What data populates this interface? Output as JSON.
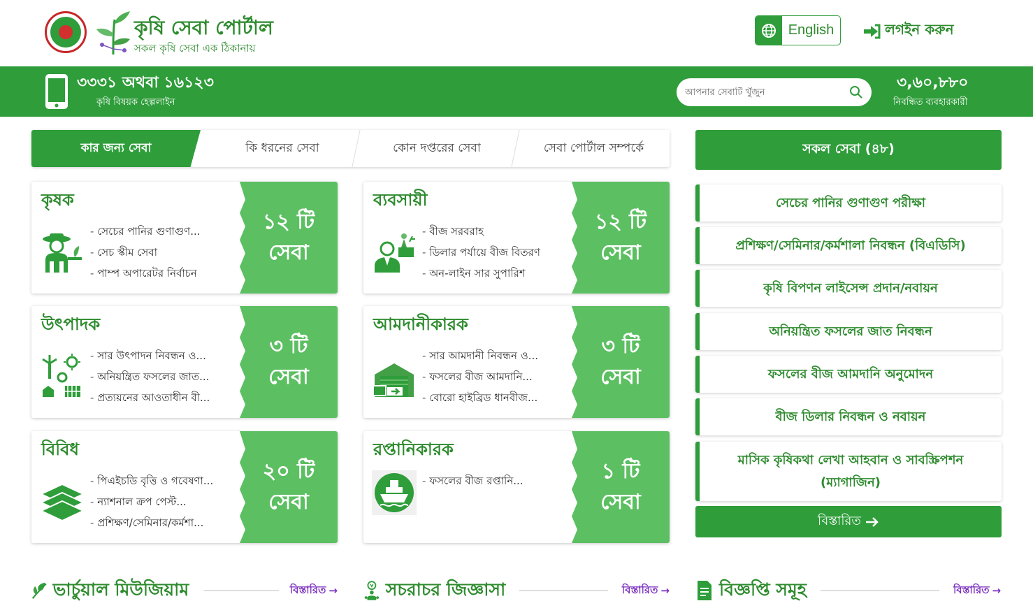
{
  "header": {
    "site_title": "কৃষি সেবা পোর্টাল",
    "site_tagline": "সকল কৃষি সেবা এক ঠিকানায়",
    "language_label": "English",
    "login_label": "লগইন করুন"
  },
  "band": {
    "hotline_number": "৩৩৩১ অথবা ১৬১২৩",
    "hotline_label": "কৃষি বিষয়ক হেল্পলাইন",
    "search_placeholder": "আপনার সেবাটি খুঁজুন",
    "registered_users": "৩,৬০,৮৮০",
    "registered_users_label": "নিবন্ধিত ব্যবহারকারী"
  },
  "tabs": [
    {
      "label": "কার জন্য সেবা",
      "active": true
    },
    {
      "label": "কি ধরনের সেবা",
      "active": false
    },
    {
      "label": "কোন দপ্তরের সেবা",
      "active": false
    },
    {
      "label": "সেবা পোর্টাল সম্পর্কে",
      "active": false
    }
  ],
  "cards": [
    {
      "title": "কৃষক",
      "icon": "farmer-icon",
      "count": "১২ টি",
      "unit": "সেবা",
      "items": [
        "সেচের পানির গুণাগুণ...",
        "সেচ স্কীম সেবা",
        "পাম্প অপারেটর নির্বাচন"
      ]
    },
    {
      "title": "ব্যবসায়ী",
      "icon": "businessman-icon",
      "count": "১২ টি",
      "unit": "সেবা",
      "items": [
        "বীজ সরবরাহ",
        "ডিলার পর্যায়ে বীজ বিতরণ",
        "অন-লাইন সার সুপারিশ"
      ]
    },
    {
      "title": "উৎপাদক",
      "icon": "producer-icon",
      "count": "৩ টি",
      "unit": "সেবা",
      "items": [
        "সার উৎপাদন নিবন্ধন ও...",
        "অনিয়ন্ত্রিত ফসলের জাত...",
        "প্রত্যয়নের আওতাধীন বী..."
      ]
    },
    {
      "title": "আমদানীকারক",
      "icon": "importer-icon",
      "count": "৩ টি",
      "unit": "সেবা",
      "items": [
        "সার আমদানী নিবন্ধন ও...",
        "ফসলের বীজ আমদানি...",
        "বোরো হাইব্রিড ধানবীজ..."
      ]
    },
    {
      "title": "বিবিধ",
      "icon": "layers-icon",
      "count": "২০ টি",
      "unit": "সেবা",
      "items": [
        "পিএইচডি বৃত্তি ও গবেষণা...",
        "ন্যাশনাল ক্রপ পেস্ট...",
        "প্রশিক্ষণ/সেমিনার/কর্মশা..."
      ]
    },
    {
      "title": "রপ্তানিকারক",
      "icon": "ship-icon",
      "count": "১ টি",
      "unit": "সেবা",
      "items": [
        "ফসলের বীজ রপ্তানি..."
      ]
    }
  ],
  "right_panel": {
    "all_services_label": "সকল সেবা (৪৮)",
    "services": [
      "সেচের পানির গুণাগুণ পরীক্ষা",
      "প্রশিক্ষণ/সেমিনার/কর্মশালা নিবন্ধন (বিএডিসি)",
      "কৃষি বিপণন লাইসেন্স প্রদান/নবায়ন",
      "অনিয়ন্ত্রিত ফসলের জাত নিবন্ধন",
      "ফসলের বীজ আমদানি অনুমোদন",
      "বীজ ডিলার নিবন্ধন ও নবায়ন",
      "মাসিক কৃষিকথা লেখা আহবান ও সাবস্ক্রিপশন (ম্যাগাজিন)"
    ],
    "details_label": "বিস্তারিত"
  },
  "bottom_sections": [
    {
      "title": "ভার্চুয়াল মিউজিয়াম",
      "icon": "leaf-icon",
      "more": "বিস্তারিত"
    },
    {
      "title": "সচরাচর জিজ্ঞাসা",
      "icon": "person-idea-icon",
      "more": "বিস্তারিত"
    },
    {
      "title": "বিজ্ঞপ্তি সমূহ",
      "icon": "document-icon",
      "more": "বিস্তারিত"
    }
  ],
  "colors": {
    "primary_green": "#2e9d3a",
    "text_green": "#2e8b2e",
    "count_green": "#5cbf62",
    "link_purple": "#7b2fbf"
  }
}
